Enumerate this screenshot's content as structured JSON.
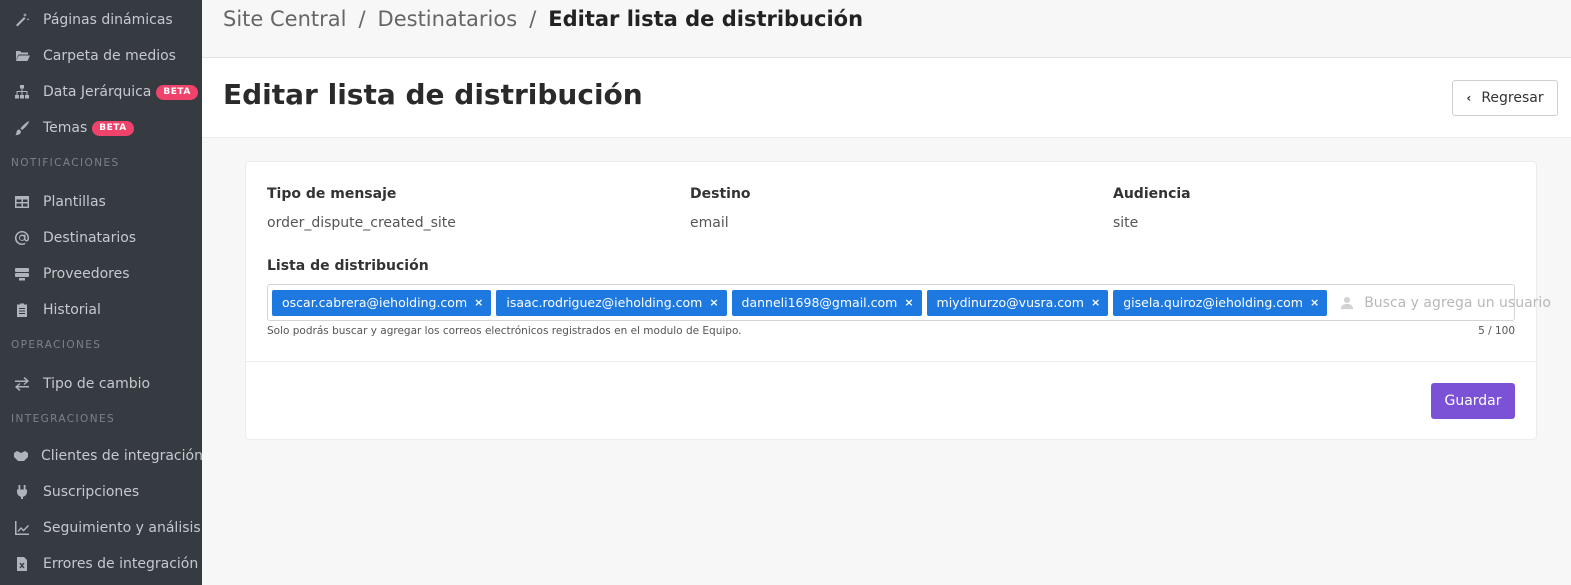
{
  "sidebar": {
    "items": [
      {
        "label": "Páginas dinámicas",
        "icon": "magic-wand-icon"
      },
      {
        "label": "Carpeta de medios",
        "icon": "folder-open-icon"
      },
      {
        "label": "Data Jerárquica",
        "icon": "sitemap-icon",
        "badge": "BETA"
      },
      {
        "label": "Temas",
        "icon": "paintbrush-icon",
        "badge": "BETA"
      },
      {
        "label": "Plantillas",
        "icon": "table-icon"
      },
      {
        "label": "Destinatarios",
        "icon": "at-sign-icon"
      },
      {
        "label": "Proveedores",
        "icon": "server-icon"
      },
      {
        "label": "Historial",
        "icon": "clipboard-icon"
      },
      {
        "label": "Tipo de cambio",
        "icon": "exchange-icon"
      },
      {
        "label": "Clientes de integración",
        "icon": "handshake-icon"
      },
      {
        "label": "Suscripciones",
        "icon": "plug-icon"
      },
      {
        "label": "Seguimiento y análisis",
        "icon": "line-chart-icon"
      },
      {
        "label": "Errores de integración",
        "icon": "file-error-icon"
      }
    ],
    "sections": [
      "NOTIFICACIONES",
      "OPERACIONES",
      "INTEGRACIONES"
    ]
  },
  "breadcrumb": {
    "items": [
      "Site Central",
      "Destinatarios",
      "Editar lista de distribución"
    ],
    "separator": "/"
  },
  "header": {
    "title": "Editar lista de distribución",
    "back_label": "Regresar"
  },
  "form": {
    "fields": [
      {
        "label": "Tipo de mensaje",
        "value": "order_dispute_created_site"
      },
      {
        "label": "Destino",
        "value": "email"
      },
      {
        "label": "Audiencia",
        "value": "site"
      }
    ],
    "distribution_label": "Lista de distribución",
    "tags": [
      "oscar.cabrera@ieholding.com",
      "isaac.rodriguez@ieholding.com",
      "danneli1698@gmail.com",
      "miydinurzo@vusra.com",
      "gisela.quiroz@ieholding.com"
    ],
    "tag_remove_symbol": "×",
    "search_placeholder": "Busca y agrega un usuario",
    "hint": "Solo podrás buscar y agregar los correos electrónicos registrados en el modulo de Equipo.",
    "counter": "5 / 100",
    "save_label": "Guardar"
  },
  "colors": {
    "sidebar_bg": "#363b41",
    "badge": "#f0436b",
    "tag": "#1d78e0",
    "primary_button": "#7b52d6"
  }
}
